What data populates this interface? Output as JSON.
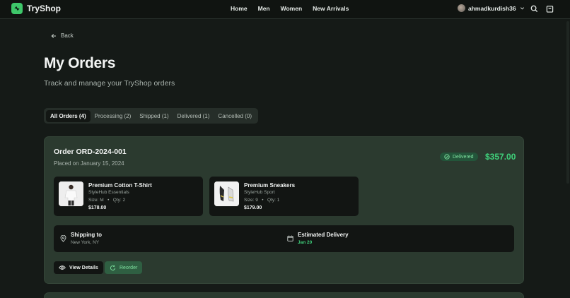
{
  "brand": {
    "name": "TryShop"
  },
  "nav": {
    "links": [
      "Home",
      "Men",
      "Women",
      "New Arrivals"
    ]
  },
  "user": {
    "name": "ahmadkurdish36"
  },
  "back": {
    "label": "Back"
  },
  "page": {
    "title": "My Orders",
    "subtitle": "Track and manage your TryShop orders"
  },
  "tabs": [
    {
      "label": "All Orders (4)",
      "active": true
    },
    {
      "label": "Processing (2)",
      "active": false
    },
    {
      "label": "Shipped (1)",
      "active": false
    },
    {
      "label": "Delivered (1)",
      "active": false
    },
    {
      "label": "Cancelled (0)",
      "active": false
    }
  ],
  "order": {
    "id": "Order ORD-2024-001",
    "placed": "Placed on January 15, 2024",
    "status": "Delivered",
    "total": "$357.00",
    "items": [
      {
        "name": "Premium Cotton T-Shirt",
        "brand": "StyleHub Essentials",
        "size": "Size: M",
        "qty": "Qty: 2",
        "price": "$178.00"
      },
      {
        "name": "Premium Sneakers",
        "brand": "StyleHub Sport",
        "size": "Size: 9",
        "qty": "Qty: 1",
        "price": "$179.00"
      }
    ],
    "shipping": {
      "label": "Shipping to",
      "value": "New York, NY"
    },
    "delivery": {
      "label": "Estimated Delivery",
      "value": "Jan 20"
    },
    "actions": {
      "view": "View Details",
      "reorder": "Reorder"
    }
  },
  "colors": {
    "accent": "#3fd07a",
    "background": "#151a17",
    "card": "#2b3a2f",
    "inner": "#121513"
  }
}
